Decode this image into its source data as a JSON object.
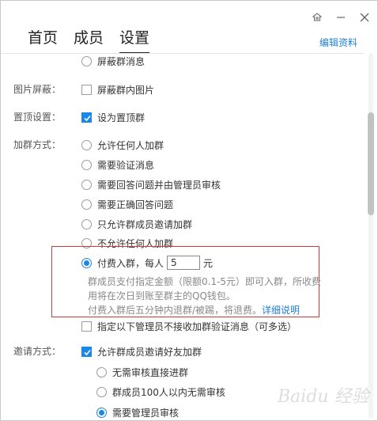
{
  "window": {
    "icons": {
      "settings": "settings-icon",
      "minimize": "minimize-icon",
      "close": "close-icon"
    }
  },
  "tabs": [
    {
      "label": "首页"
    },
    {
      "label": "成员"
    },
    {
      "label": "设置"
    }
  ],
  "header": {
    "edit_link": "编辑资料"
  },
  "sections": {
    "top_option": "屏蔽群消息",
    "image_block": {
      "label": "图片屏蔽：",
      "option": "屏蔽群内图片"
    },
    "pin": {
      "label": "置顶设置：",
      "option": "设为置顶群"
    },
    "join": {
      "label": "加群方式：",
      "options": [
        "允许任何人加群",
        "需要验证消息",
        "需要回答问题并由管理员审核",
        "需要正确回答问题",
        "只允许群成员邀请加群",
        "不允许任何人加群"
      ],
      "paid": {
        "prefix": "付费入群，每人",
        "value": "5",
        "unit": "元",
        "desc1": "群成员支付指定金额（限额0.1-5元）即可入群，所收费",
        "desc2": "用将在次日到账至群主的QQ钱包。",
        "desc3": "付费入群后五分钟内退群/被踢，将退费。",
        "detail_link": "详细说明"
      },
      "admin_option": "指定以下管理员不接收加群验证消息（可多选）"
    },
    "invite": {
      "label": "邀请方式：",
      "option": "允许群成员邀请好友加群",
      "sub_options": [
        "无需审核直接进群",
        "群成员100人以内无需审核",
        "需要管理员审核"
      ]
    }
  },
  "watermark": "Baidu 经验",
  "colors": {
    "accent": "#1b87e6",
    "link": "#1f7fd8",
    "highlight": "#d23a3a"
  }
}
